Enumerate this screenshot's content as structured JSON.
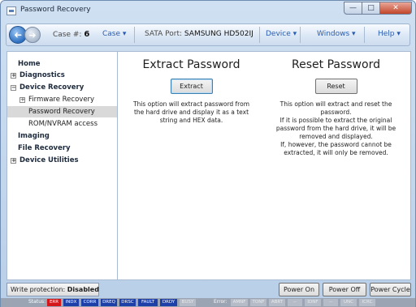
{
  "window": {
    "title": "Password Recovery",
    "controls": {
      "minimize": "—",
      "maximize": "□",
      "close": "✕"
    }
  },
  "toolbar": {
    "case_label": "Case #:",
    "case_value": "6",
    "case_menu": "Case ▾",
    "port_label": "SATA Port:",
    "port_value": "SAMSUNG HD502IJ",
    "device_menu": "Device ▾",
    "windows_menu": "Windows ▾",
    "help_menu": "Help ▾",
    "back_glyph": "➜",
    "forward_glyph": "➜"
  },
  "sidebar": {
    "expand_glyph": "+",
    "collapse_glyph": "−",
    "items": [
      {
        "label": "Home"
      },
      {
        "label": "Diagnostics"
      },
      {
        "label": "Device Recovery"
      },
      {
        "label": "Firmware Recovery"
      },
      {
        "label": "Password Recovery"
      },
      {
        "label": "ROM/NVRAM access"
      },
      {
        "label": "Imaging"
      },
      {
        "label": "File Recovery"
      },
      {
        "label": "Device Utilities"
      }
    ]
  },
  "extract": {
    "title": "Extract Password",
    "button": "Extract",
    "lines": [
      "This option will extract password from",
      "the hard drive and display it as a text",
      "string and HEX data."
    ]
  },
  "reset": {
    "title": "Reset Password",
    "button": "Reset",
    "lines": [
      "This option will extract and reset the",
      "password.",
      "If it is possible to extract the original",
      "password from the hard drive, it will be",
      "removed and displayed.",
      "If, however, the password cannot be",
      "extracted, it will only be removed."
    ]
  },
  "bottom": {
    "write_protection_label": "Write protection:",
    "write_protection_value": "Disabled",
    "power_on": "Power On",
    "power_off": "Power Off",
    "power_cycle": "Power Cycle"
  },
  "status": {
    "status_label": "Status:",
    "error_label": "Error:",
    "status_flags": [
      "ERR",
      "INDX",
      "CORR",
      "DREQ",
      "DRSC",
      "FAULT",
      "DRDY",
      "BUSY"
    ],
    "error_flags": [
      "AMNF",
      "TONF",
      "ABRT",
      "--",
      "IDNF",
      "--",
      "UNC",
      "ICRC"
    ]
  },
  "colors": {
    "flag_red": "#d2161a",
    "flag_blue": "#1d3fa8",
    "flag_off": "#b5bcc7"
  }
}
